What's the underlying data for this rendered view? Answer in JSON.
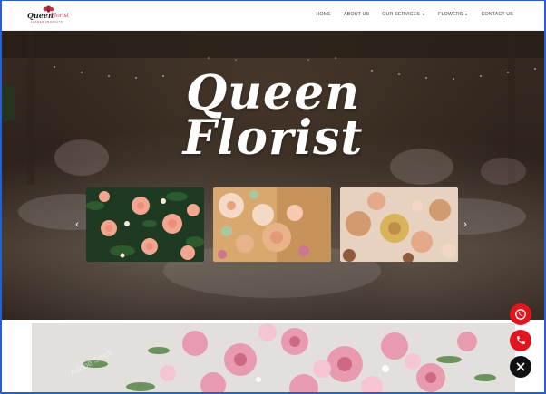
{
  "brand": {
    "name": "Queen",
    "name_suffix": "Florist",
    "tagline": "FLOWER PRODUCTS"
  },
  "nav": {
    "items": [
      {
        "label": "HOME",
        "dropdown": false
      },
      {
        "label": "ABOUT US",
        "dropdown": false
      },
      {
        "label": "OUR SERVICES",
        "dropdown": true
      },
      {
        "label": "FLOWERS",
        "dropdown": true
      },
      {
        "label": "CONTACT US",
        "dropdown": false
      }
    ]
  },
  "hero": {
    "title_line1": "Queen",
    "title_line2": "Florist",
    "prev_arrow": "‹",
    "next_arrow": "›",
    "slides": [
      {
        "icon": "peach-roses-photo"
      },
      {
        "icon": "ranunculus-bouquet-photo"
      },
      {
        "icon": "dried-flower-arrangement-photo"
      }
    ]
  },
  "banner": {
    "icon": "pink-rose-arrangement-photo",
    "watermark": "Adobe Stock"
  },
  "fabs": {
    "whatsapp": {
      "icon": "whatsapp-icon",
      "color": "#e0161f"
    },
    "call": {
      "icon": "phone-icon",
      "color": "#e0161f"
    },
    "close": {
      "icon": "close-icon",
      "color": "#111111"
    }
  },
  "colors": {
    "accent": "#c0314a",
    "frame": "#2a5fd0"
  }
}
